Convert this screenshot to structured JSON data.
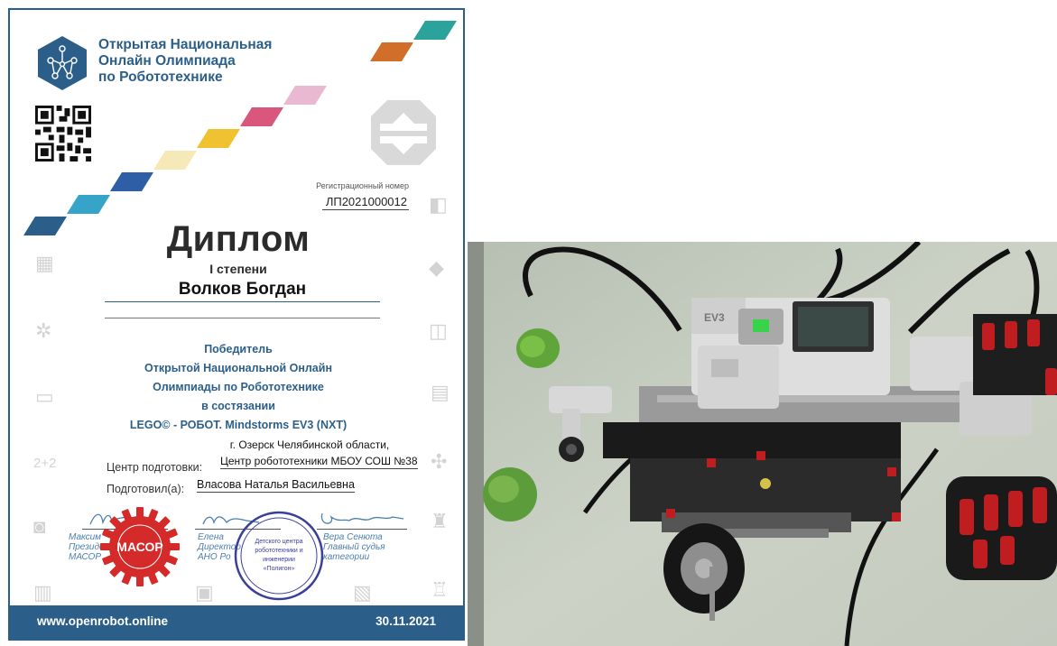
{
  "certificate": {
    "org_name_lines": [
      "Открытая Национальная",
      "Онлайн Олимпиада",
      "по Робототехнике"
    ],
    "registration_label": "Регистрационный номер",
    "registration_number": "ЛП2021000012",
    "title": "Диплом",
    "degree": "I степени",
    "student_name": "Волков Богдан",
    "winner_lines": [
      "Победитель",
      "Открытой Национальной Онлайн",
      "Олимпиады по Робототехнике",
      "в состязании",
      "LEGO© - РОБОТ. Mindstorms EV3 (NXT)"
    ],
    "center_city": "г. Озерск Челябинской области,",
    "center_label": "Центр подготовки:",
    "center_value": "Центр робототехники МБОУ СОШ №38",
    "prepared_label": "Подготовил(а):",
    "prepared_value": "Власова Наталья Васильевна",
    "signatures": [
      {
        "lines": [
          "Максим",
          "Президе",
          "МАСОР"
        ]
      },
      {
        "lines": [
          "Елена",
          "Директор",
          "АНО Ро"
        ]
      },
      {
        "lines": [
          "Вера Сенюта",
          "Главный судья",
          "категории"
        ]
      }
    ],
    "seal_red_text": "МАСОР",
    "seal_blue_lines": [
      "Детского центра",
      "робототехники и",
      "инженерии",
      "«Полигон»"
    ],
    "footer_url": "www.openrobot.online",
    "footer_date": "30.11.2021",
    "colors": {
      "brand_blue": "#2b5f8a",
      "stripe_colors": [
        "#2b5f8a",
        "#35a4c8",
        "#2d5ea6",
        "#f6e9b8",
        "#f0c131",
        "#d9567c",
        "#e9b9d2",
        "#d16f2a",
        "#2ba39c"
      ],
      "seal_red": "#d42a2a",
      "seal_blue": "#3a3f9a"
    }
  },
  "photo": {
    "subject": "LEGO Mindstorms EV3 robot",
    "brick_label": "EV3"
  }
}
